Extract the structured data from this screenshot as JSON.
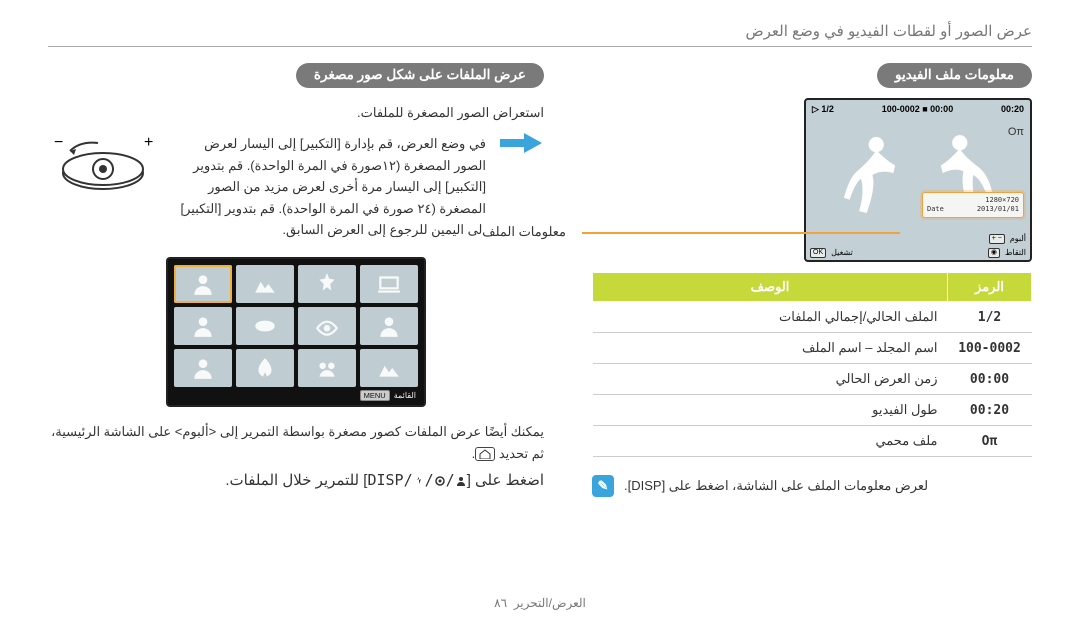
{
  "page_header": "عرض الصور أو لقطات الفيديو في وضع العرض",
  "video_section": {
    "pill": "معلومات ملف الفيديو",
    "screen": {
      "top_left": "▷ 1/2",
      "top_mid": "100-0002  ■ 00:00",
      "top_right": "00:20",
      "lock": "Oπ",
      "fileinfo_lines": [
        {
          "l": "",
          "r": "1280×720"
        },
        {
          "l": "Date",
          "r": "2013/01/01"
        }
      ],
      "bot_play_icon": "OK",
      "bot_play_label": "تشغيل",
      "bot_album_icon": "⌂",
      "bot_album_label": "ألبوم",
      "bot_shots_icon": "◉",
      "bot_shots_label": "التقاط"
    },
    "fileinfo_label": "معلومات الملف",
    "table": {
      "hdr_sym": "الرمز",
      "hdr_desc": "الوصف",
      "rows": [
        {
          "sym": "1/2",
          "desc": "الملف الحالي/إجمالي الملفات"
        },
        {
          "sym": "100-0002",
          "desc": "اسم المجلد – اسم الملف"
        },
        {
          "sym": "00:00",
          "desc": "زمن العرض الحالي"
        },
        {
          "sym": "00:20",
          "desc": "طول الفيديو"
        },
        {
          "sym": "Oπ",
          "desc": "ملف محمي"
        }
      ]
    },
    "note": "لعرض معلومات الملف على الشاشة، اضغط على [DISP]."
  },
  "thumbs_section": {
    "pill": "عرض الملفات على شكل صور مصغرة",
    "sub": "استعراض الصور المصغرة للملفات.",
    "para": "في وضع العرض، قم بإدارة [التكبير] إلى اليسار لعرض الصور المصغرة (١٢صورة في المرة الواحدة). قم بتدوير [التكبير] إلى اليسار مرة أخرى لعرض مزيد من الصور المصغرة (٢٤ صورة في المرة الواحدة). قم بتدوير [التكبير] إلى اليمين للرجوع إلى العرض السابق.",
    "thumbs_footer_menu": "MENU",
    "thumbs_footer_label": "القائمة",
    "album_para": "يمكنك أيضًا عرض الملفات كصور مصغرة بواسطة التمرير إلى <ألبوم> على الشاشة الرئيسية، ثم تحديد ",
    "instruction_pre": "اضغط على [",
    "instruction_keys": "DISP/ / / ",
    "instruction_post": "] للتمرير خلال الملفات."
  },
  "footer": {
    "section": "العرض/التحرير",
    "page": "٨٦"
  }
}
